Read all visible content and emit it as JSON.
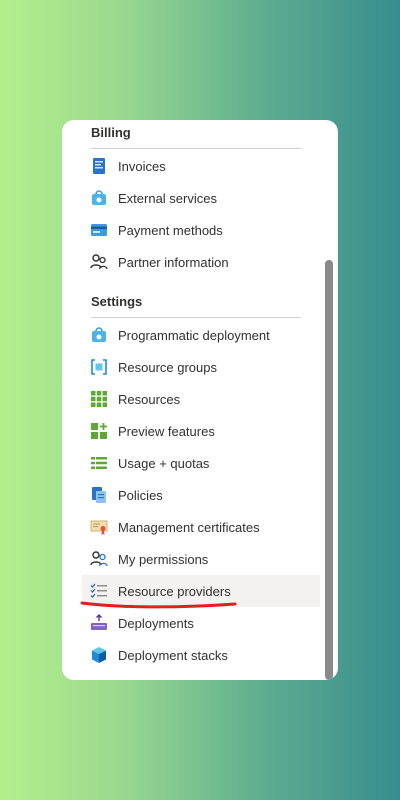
{
  "billing": {
    "title": "Billing",
    "items": [
      {
        "label": "Invoices",
        "icon": "invoice-icon"
      },
      {
        "label": "External services",
        "icon": "bag-icon"
      },
      {
        "label": "Payment methods",
        "icon": "card-icon"
      },
      {
        "label": "Partner information",
        "icon": "people-icon"
      }
    ]
  },
  "settings": {
    "title": "Settings",
    "items": [
      {
        "label": "Programmatic deployment",
        "icon": "bag-icon"
      },
      {
        "label": "Resource groups",
        "icon": "resource-group-icon"
      },
      {
        "label": "Resources",
        "icon": "grid-icon"
      },
      {
        "label": "Preview features",
        "icon": "preview-icon"
      },
      {
        "label": "Usage + quotas",
        "icon": "list-icon"
      },
      {
        "label": "Policies",
        "icon": "policy-icon"
      },
      {
        "label": "Management certificates",
        "icon": "certificate-icon"
      },
      {
        "label": "My permissions",
        "icon": "user-permissions-icon"
      },
      {
        "label": "Resource providers",
        "icon": "checklist-icon",
        "selected": true
      },
      {
        "label": "Deployments",
        "icon": "deploy-icon"
      },
      {
        "label": "Deployment stacks",
        "icon": "stack-icon"
      }
    ]
  },
  "colors": {
    "annotation_underline": "#e02020",
    "selected_background": "#f3f2f1"
  }
}
